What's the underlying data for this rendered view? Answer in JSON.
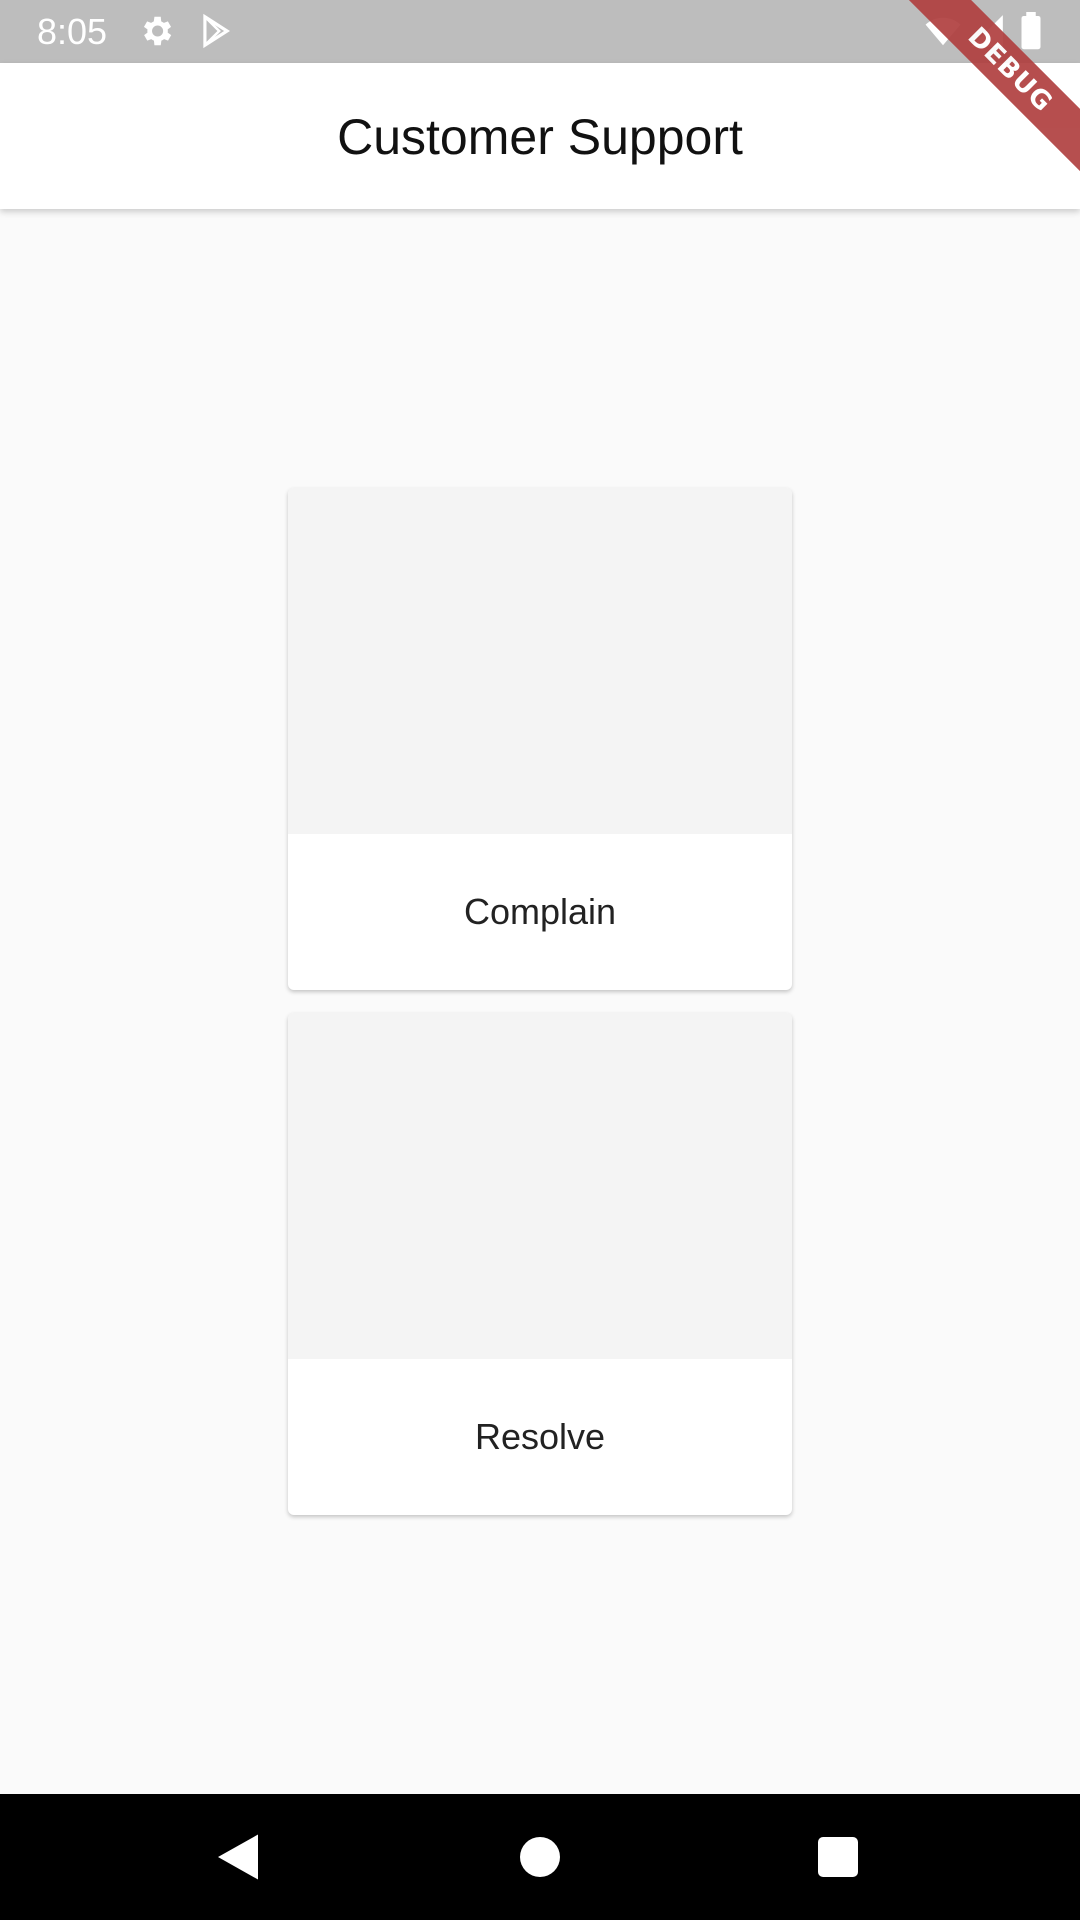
{
  "status_bar": {
    "time": "8:05",
    "icons": [
      "settings-icon",
      "play-store-icon",
      "wifi-icon",
      "signal-icon",
      "battery-icon"
    ]
  },
  "app_bar": {
    "title": "Customer Support"
  },
  "debug_banner": {
    "label": "DEBUG",
    "color": "#b04040"
  },
  "cards": [
    {
      "label": "Complain"
    },
    {
      "label": "Resolve"
    }
  ],
  "nav_bar": {
    "buttons": [
      "back-icon",
      "home-icon",
      "recents-icon"
    ]
  },
  "colors": {
    "background": "#fafafa",
    "status_bar": "#bdbdbd",
    "card_image_placeholder": "#f4f4f4",
    "nav_bar": "#000000"
  }
}
